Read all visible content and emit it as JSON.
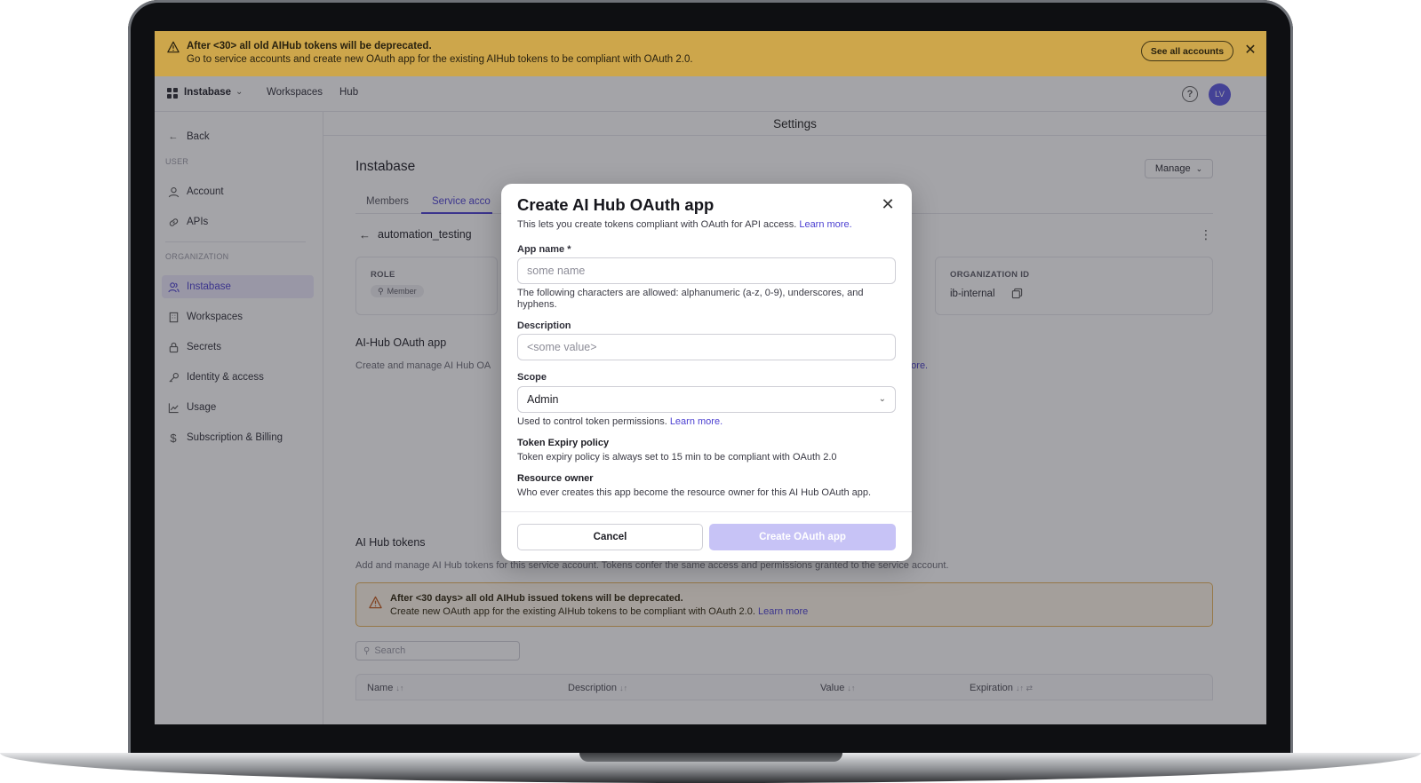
{
  "banner": {
    "line1": "After <30> all old AIHub tokens will be deprecated.",
    "line2": "Go to service accounts and create new OAuth app for the existing AIHub tokens to be compliant with OAuth 2.0.",
    "see_all_label": "See all accounts",
    "close_label": "✕",
    "color": "#f2c251"
  },
  "nav": {
    "brand": "Instabase",
    "links": [
      "Workspaces",
      "Hub"
    ],
    "help_label": "?",
    "avatar_initials": "LV",
    "accent": "#5b56e0"
  },
  "settings_title": "Settings",
  "sidebar": {
    "back_label": "Back",
    "user_heading": "USER",
    "user_items": [
      {
        "label": "Account",
        "icon": "user-icon"
      },
      {
        "label": "APIs",
        "icon": "link-icon"
      }
    ],
    "org_heading": "ORGANIZATION",
    "org_items": [
      {
        "label": "Instabase",
        "icon": "users-icon",
        "active": true
      },
      {
        "label": "Workspaces",
        "icon": "building-icon"
      },
      {
        "label": "Secrets",
        "icon": "lock-icon"
      },
      {
        "label": "Identity & access",
        "icon": "key-icon"
      },
      {
        "label": "Usage",
        "icon": "chart-icon"
      },
      {
        "label": "Subscription & Billing",
        "icon": "dollar-icon"
      }
    ]
  },
  "main": {
    "org_title": "Instabase",
    "manage_label": "Manage",
    "tabs": [
      "Members",
      "Service acco"
    ],
    "active_tab": 1,
    "service_account": "automation_testing",
    "cards": {
      "role_label": "ROLE",
      "role_value": "Member",
      "org_id_label": "ORGANIZATION ID",
      "org_id_value": "ib-internal"
    },
    "oauth_section": {
      "title": "AI-Hub OAuth app",
      "desc": "Create and manage AI Hub OA",
      "desc_tail": "more."
    },
    "tokens_section": {
      "title": "AI Hub tokens",
      "desc": "Add and manage AI Hub tokens for this service account. Tokens confer the same access and permissions granted to the service account."
    },
    "warning": {
      "line1": "After <30 days> all old AIHub issued tokens will be deprecated.",
      "line2": "Create new OAuth app for the existing AIHub tokens to be compliant with OAuth 2.0.",
      "link": "Learn more"
    },
    "search_placeholder": "Search",
    "table_headers": [
      "Name",
      "Description",
      "Value",
      "Expiration"
    ]
  },
  "modal": {
    "title": "Create AI Hub OAuth app",
    "subtitle": "This lets you create tokens compliant with OAuth for API access.",
    "subtitle_link": "Learn more.",
    "app_name_label": "App name *",
    "app_name_placeholder": "some name",
    "app_name_hint": "The following characters are allowed: alphanumeric (a-z, 0-9), underscores, and hyphens.",
    "description_label": "Description",
    "description_placeholder": "<some value>",
    "scope_label": "Scope",
    "scope_value": "Admin",
    "scope_hint": "Used to control token permissions.",
    "scope_hint_link": "Learn more.",
    "expiry_title": "Token Expiry policy",
    "expiry_text": "Token expiry policy is always set to 15 min to be compliant with OAuth 2.0",
    "owner_title": "Resource owner",
    "owner_text": "Who ever creates this app become the resource owner for this AI Hub OAuth app.",
    "cancel_label": "Cancel",
    "create_label": "Create OAuth app",
    "create_color": "#c7c3f6"
  }
}
